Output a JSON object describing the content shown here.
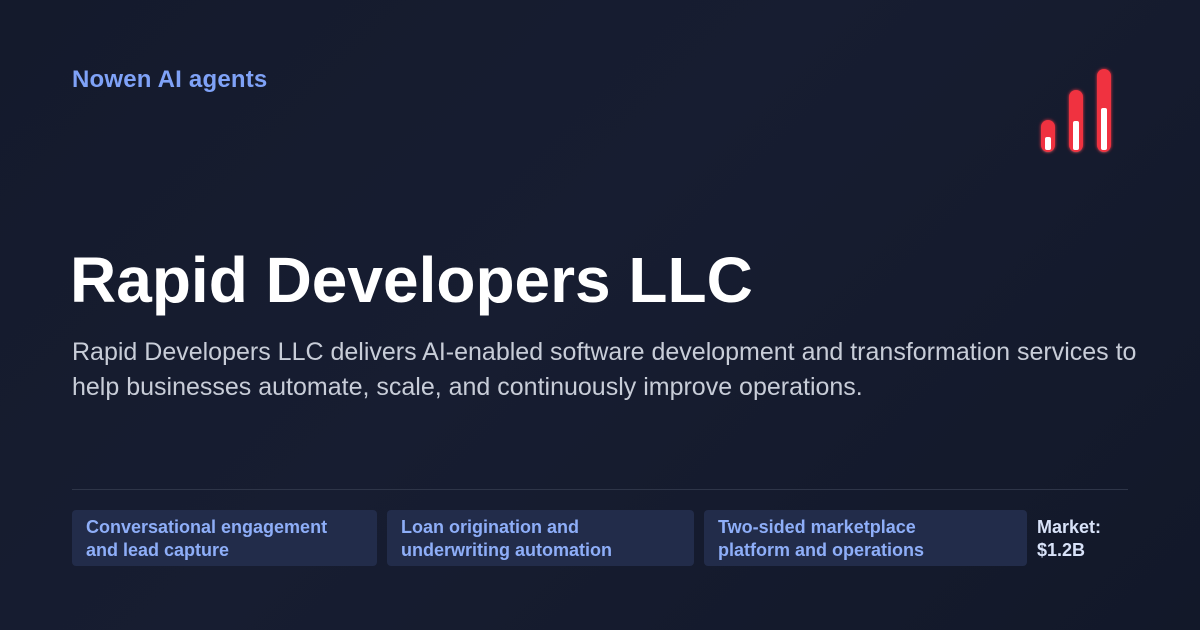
{
  "header": {
    "brand": "Nowen AI agents",
    "logo_icon": "signal-bars-icon"
  },
  "company": {
    "name": "Rapid Developers LLC",
    "description": "Rapid Developers LLC delivers AI-enabled software development and transformation services to help businesses automate, scale, and continuously improve operations."
  },
  "tags": [
    {
      "line1": "Conversational engagement",
      "line2": "and lead capture"
    },
    {
      "line1": "Loan origination and",
      "line2": "underwriting automation"
    },
    {
      "line1": "Two-sided marketplace",
      "line2": "platform and operations"
    }
  ],
  "market": {
    "label": "Market:",
    "value": "$1.2B"
  },
  "colors": {
    "background": "#161c2f",
    "brand_accent": "#7fa2f7",
    "tag_background": "#222c4a",
    "logo_red": "#f0313f"
  }
}
